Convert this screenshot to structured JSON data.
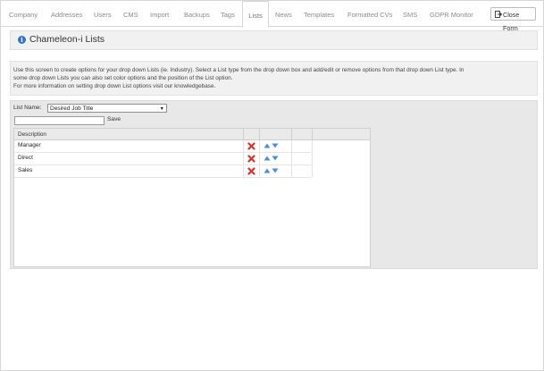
{
  "tabs": [
    {
      "label": "Company"
    },
    {
      "label": "Addresses"
    },
    {
      "label": "Users"
    },
    {
      "label": "CMS"
    },
    {
      "label": "Import"
    },
    {
      "label": "Backups"
    },
    {
      "label": "Tags"
    },
    {
      "label": "Lists"
    },
    {
      "label": "News"
    },
    {
      "label": "Templates"
    },
    {
      "label": "Formatted CVs"
    },
    {
      "label": "SMS"
    },
    {
      "label": "GDPR Monitor"
    }
  ],
  "active_tab": "Lists",
  "close_button": {
    "label": "Close Form"
  },
  "page_title": "Chameleon-i Lists",
  "info_lines": [
    "Use this screen to create options for your drop down Lists (ie. Industry). Select a List type from the drop down box and add/edit or remove options from that drop down List type. In",
    "some drop down Lists you can also set color options and the position of the List option.",
    "For more information on setting drop down List options visit our knowledgebase."
  ],
  "list_name": {
    "label": "List Name:",
    "selected": "Desired Job Title"
  },
  "new_option": {
    "value": "",
    "save_label": "Save"
  },
  "grid": {
    "header": "Description",
    "rows": [
      {
        "description": "Manager"
      },
      {
        "description": "Direct"
      },
      {
        "description": "Sales"
      }
    ]
  },
  "colors": {
    "accent": "#2e74c8",
    "delete": "#d9332b",
    "arrow": "#4a8fd9"
  }
}
